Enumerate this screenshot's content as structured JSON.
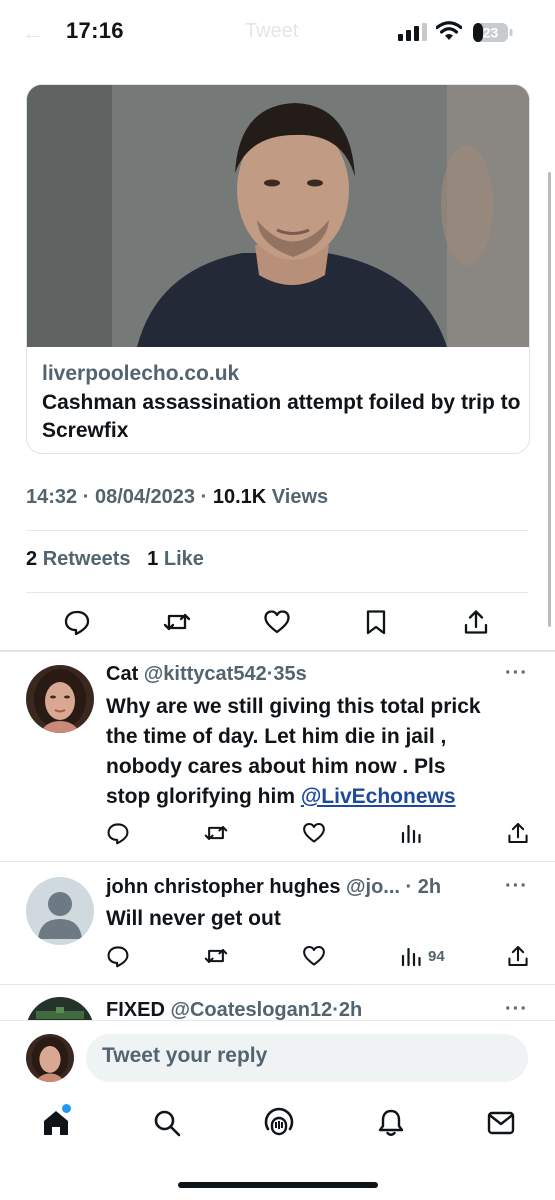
{
  "status_bar": {
    "time": "17:16",
    "battery": "23",
    "faded_title": "Tweet",
    "back_glyph": "←"
  },
  "link_card": {
    "domain": "liverpoolecho.co.uk",
    "title": "Cashman assassination attempt foiled by trip to Screwfix"
  },
  "tweet_meta": {
    "time": "14:32",
    "date": "08/04/2023",
    "views_count": "10.1K",
    "views_label": "Views",
    "sep": "·"
  },
  "tweet_stats": {
    "retweets_count": "2",
    "retweets_label": "Retweets",
    "likes_count": "1",
    "likes_label": "Like"
  },
  "tweet_actions": [
    "reply-icon",
    "retweet-icon",
    "like-icon",
    "bookmark-icon",
    "share-icon"
  ],
  "replies": [
    {
      "name": "Cat",
      "handle": "@kittycat542",
      "time": "35s",
      "text_lines": [
        "Why are we still giving this total prick",
        "the time of day. Let him die in jail ,",
        "nobody cares about him now . Pls",
        "stop glorifying him "
      ],
      "mention": "@LivEchonews",
      "views": ""
    },
    {
      "name": "john christopher hughes",
      "handle": "@jo...",
      "time": "2h",
      "text_lines": [
        "Will never get out"
      ],
      "views": "94"
    },
    {
      "name": "FIXED",
      "handle": "@Coateslogan12",
      "time": "2h"
    }
  ],
  "more_glyph": "···",
  "composer": {
    "placeholder": "Tweet your reply"
  },
  "bottom_nav": [
    "home-icon",
    "search-icon",
    "spaces-icon",
    "notifications-icon",
    "messages-icon"
  ],
  "colors": {
    "text": "#0f1419",
    "secondary": "#536471",
    "mention": "#1d4a9b",
    "accent": "#1d9bf0",
    "reply_box": "#eff3f4"
  }
}
